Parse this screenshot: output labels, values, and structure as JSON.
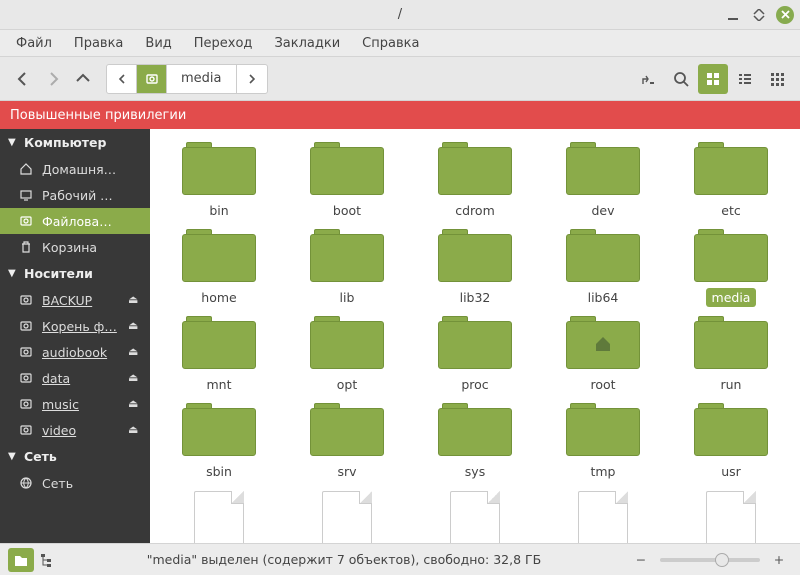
{
  "window": {
    "title": "/"
  },
  "menubar": {
    "file": "Файл",
    "edit": "Правка",
    "view": "Вид",
    "go": "Переход",
    "bookmarks": "Закладки",
    "help": "Справка"
  },
  "pathbar": {
    "segment1": "media"
  },
  "privilege_bar": "Повышенные привилегии",
  "sidebar": {
    "cat_computer": "Компьютер",
    "cat_media": "Носители",
    "cat_network": "Сеть",
    "computer": [
      {
        "label": "Домашня…"
      },
      {
        "label": "Рабочий …"
      },
      {
        "label": "Файлова…"
      },
      {
        "label": "Корзина"
      }
    ],
    "media": [
      {
        "label": "BACKUP"
      },
      {
        "label": "Корень ф…"
      },
      {
        "label": "audiobook"
      },
      {
        "label": "data"
      },
      {
        "label": "music"
      },
      {
        "label": "video"
      }
    ],
    "network": [
      {
        "label": "Сеть"
      }
    ]
  },
  "folders": {
    "0": "bin",
    "1": "boot",
    "2": "cdrom",
    "3": "dev",
    "4": "etc",
    "5": "home",
    "6": "lib",
    "7": "lib32",
    "8": "lib64",
    "9": "media",
    "10": "mnt",
    "11": "opt",
    "12": "proc",
    "13": "root",
    "14": "run",
    "15": "sbin",
    "16": "srv",
    "17": "sys",
    "18": "tmp",
    "19": "usr"
  },
  "statusbar": {
    "text": "\"media\" выделен (содержит 7 объектов), свободно: 32,8 ГБ"
  }
}
